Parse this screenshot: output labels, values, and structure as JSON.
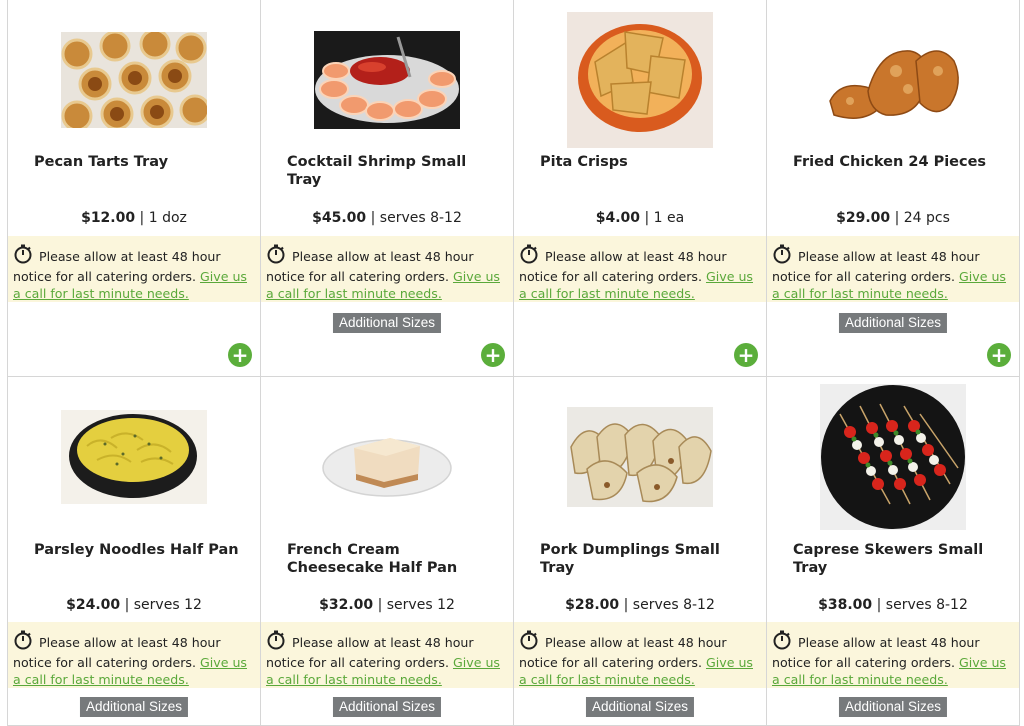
{
  "notice": {
    "text": "Please allow at least 48 hour notice for all catering orders.",
    "link": "Give us a call for last minute needs."
  },
  "additional_sizes_label": "Additional Sizes",
  "add_icon": "plus-circle-icon",
  "colors": {
    "accent_green": "#5bae3b",
    "notice_bg": "#fbf6dc",
    "button_gray": "#777a7c"
  },
  "products": [
    {
      "name": "Pecan Tarts Tray",
      "price": "$12.00",
      "unit": "1 doz",
      "has_sizes": false
    },
    {
      "name": "Cocktail Shrimp Small Tray",
      "price": "$45.00",
      "unit": "serves 8-12",
      "has_sizes": true
    },
    {
      "name": "Pita Crisps",
      "price": "$4.00",
      "unit": "1 ea",
      "has_sizes": false
    },
    {
      "name": "Fried Chicken 24 Pieces",
      "price": "$29.00",
      "unit": "24 pcs",
      "has_sizes": true
    },
    {
      "name": "Parsley Noodles Half Pan",
      "price": "$24.00",
      "unit": "serves 12",
      "has_sizes": true
    },
    {
      "name": "French Cream Cheesecake Half Pan",
      "price": "$32.00",
      "unit": "serves 12",
      "has_sizes": true
    },
    {
      "name": "Pork Dumplings Small Tray",
      "price": "$28.00",
      "unit": "serves 8-12",
      "has_sizes": true
    },
    {
      "name": "Caprese Skewers Small Tray",
      "price": "$38.00",
      "unit": "serves 8-12",
      "has_sizes": true
    }
  ]
}
